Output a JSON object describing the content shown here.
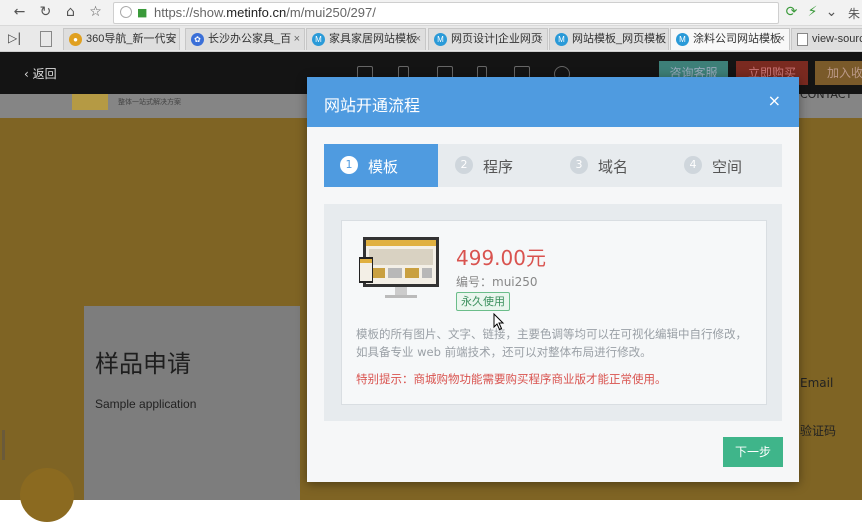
{
  "browser": {
    "url_host": "https://show.",
    "url_main": "metinfo.cn",
    "url_path": "/m/mui250/297/",
    "right_text": "朱",
    "tabs": [
      {
        "label": "360导航_新一代安",
        "icon_color": "#e0a020"
      },
      {
        "label": "长沙办公家具_百",
        "icon_color": "#3a6fd8"
      },
      {
        "label": "家具家居网站模板",
        "icon_color": "#2a9ad8"
      },
      {
        "label": "网页设计|企业网页",
        "icon_color": "#2a9ad8"
      },
      {
        "label": "网站模板_网页模板",
        "icon_color": "#2a9ad8"
      },
      {
        "label": "涂料公司网站模板",
        "icon_color": "#2a9ad8"
      },
      {
        "label": "view-sourc",
        "icon_color": "#888888"
      }
    ]
  },
  "site": {
    "back_label": "返回",
    "consult_label": "咨询客服",
    "buy_label": "立即购买",
    "fav_label": "加入收",
    "logo_tagline": "整体一站式解决方案",
    "contact_label": "CONTACT",
    "sample_title": "样品申请",
    "sample_sub": "Sample application",
    "email_label": "Email",
    "captcha_label": "验证码"
  },
  "modal": {
    "title": "网站开通流程",
    "close": "×",
    "steps": [
      {
        "num": "1",
        "label": "模板"
      },
      {
        "num": "2",
        "label": "程序"
      },
      {
        "num": "3",
        "label": "域名"
      },
      {
        "num": "4",
        "label": "空间"
      }
    ],
    "price": "499.00元",
    "code": "编号：mui250",
    "badge": "永久使用",
    "description": "模板的所有图片、文字、链接，主要色调等均可以在可视化编辑中自行修改，如具备专业 web 前端技术，还可以对整体布局进行修改。",
    "warning": "特别提示：商城购物功能需要购买程序商业版才能正常使用。",
    "next_label": "下一步"
  }
}
